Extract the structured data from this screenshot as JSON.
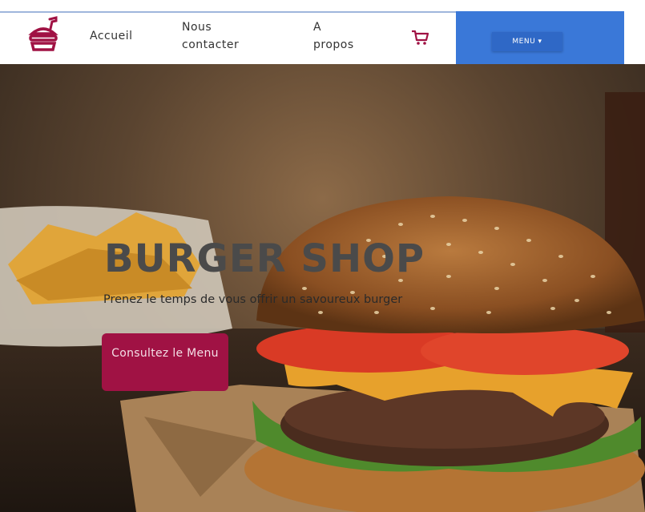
{
  "nav": {
    "logo_icon": "burger-logo-icon",
    "home_label": "Accueil",
    "contact_label": "Nous contacter",
    "about_label": "A propos",
    "cart_icon": "shopping-cart-icon",
    "menu_label": "MENU ▾"
  },
  "hero": {
    "title": "BURGER SHOP",
    "subtitle": "Prenez le temps de vous offrir un savoureux burger",
    "cta_label": "Consultez le Menu"
  },
  "colors": {
    "brand": "#a01244",
    "menu_panel": "#3a78d8",
    "title": "#4a4a4a"
  }
}
